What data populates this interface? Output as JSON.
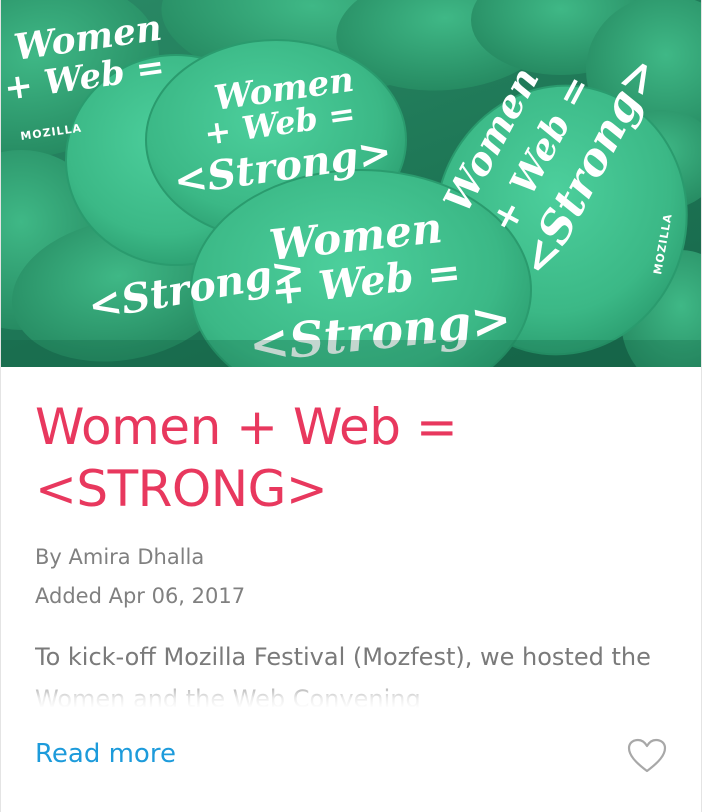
{
  "card": {
    "image": {
      "button_script_line1": "Women",
      "button_script_line2": "+ Web =",
      "button_script_line3": "<Strong>",
      "button_brand": "MOZILLA",
      "badge_color": "#3fbf8e",
      "text_color": "#ffffff"
    },
    "title": "Women + Web = <STRONG>",
    "author": "By Amira Dhalla",
    "date_added": "Added Apr 06, 2017",
    "excerpt": "To kick-off Mozilla Festival (Mozfest), we hosted the Women and the Web Convening",
    "read_more_label": "Read more",
    "like_icon": "heart-outline-icon",
    "colors": {
      "title": "#e8385e",
      "link": "#1d9bdb",
      "meta": "#808080"
    }
  }
}
